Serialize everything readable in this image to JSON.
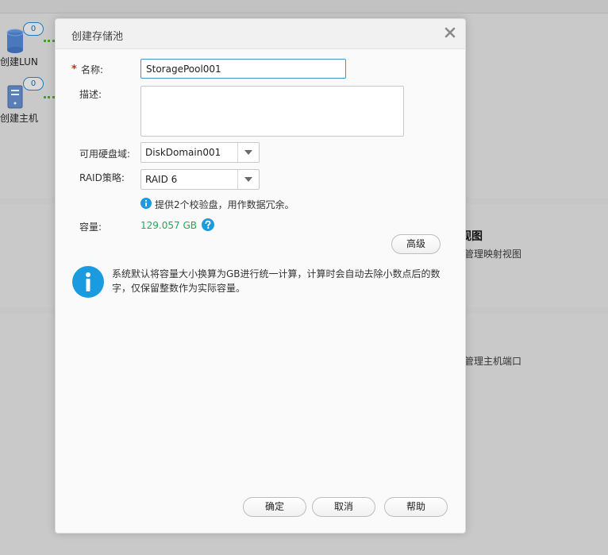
{
  "background": {
    "nodes": [
      {
        "label": "创建LUN",
        "badge": "0"
      },
      {
        "label": "创建主机",
        "badge": "0"
      }
    ],
    "section_title_partial": "视图",
    "section_desc_1": "管理映射视图",
    "section_desc_2": "管理主机端口"
  },
  "dialog": {
    "title": "创建存储池",
    "close_icon": "close-icon",
    "name_label": "名称:",
    "name_value": "StoragePool001",
    "description_label": "描述:",
    "description_value": "",
    "disk_domain_label": "可用硬盘域:",
    "disk_domain_value": "DiskDomain001",
    "raid_label": "RAID策略:",
    "raid_value": "RAID 6",
    "raid_hint": "提供2个校验盘，用作数据冗余。",
    "capacity_label": "容量:",
    "capacity_value": "129.057 GB",
    "advanced_button": "高级",
    "info_message": "系统默认将容量大小换算为GB进行统一计算，计算时会自动去除小数点后的数字，仅保留整数作为实际容量。",
    "ok_button": "确定",
    "cancel_button": "取消",
    "help_button": "帮助"
  },
  "colors": {
    "accent": "#1a9be0",
    "capacity_green": "#20a85a",
    "required_red": "#e02020",
    "overlay_gray": "#c6c6c6"
  }
}
